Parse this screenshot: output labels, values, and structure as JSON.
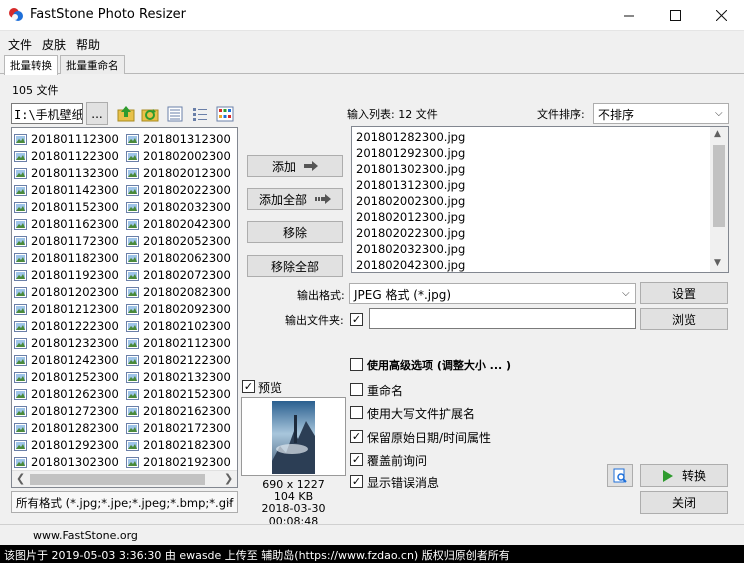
{
  "window": {
    "title": "FastStone Photo Resizer",
    "minimize": "—",
    "maximize": "☐",
    "close": "✕"
  },
  "menu": [
    "文件",
    "皮肤",
    "帮助"
  ],
  "tabs": [
    "批量转换",
    "批量重命名"
  ],
  "source": {
    "file_count": "105 文件",
    "path": "I:\\手机壁纸\\",
    "browse_label": "...",
    "col1": [
      "201801112300",
      "201801122300",
      "201801132300",
      "201801142300",
      "201801152300",
      "201801162300",
      "201801172300",
      "201801182300",
      "201801192300",
      "201801202300",
      "201801212300",
      "201801222300",
      "201801232300",
      "201801242300",
      "201801252300",
      "201801262300",
      "201801272300",
      "201801282300",
      "201801292300",
      "201801302300"
    ],
    "col2": [
      "201801312300",
      "201802002300",
      "201802012300",
      "201802022300",
      "201802032300",
      "201802042300",
      "201802052300",
      "201802062300",
      "201802072300",
      "201802082300",
      "201802092300",
      "201802102300",
      "201802112300",
      "201802122300",
      "201802132300",
      "201802152300",
      "201802162300",
      "201802172300",
      "201802182300",
      "201802192300"
    ],
    "filter": "所有格式 (*.jpg;*.jpe;*.jpeg;*.bmp;*.gif"
  },
  "buttons": {
    "add": "添加",
    "add_all": "添加全部",
    "remove": "移除",
    "remove_all": "移除全部",
    "settings": "设置",
    "browse": "浏览",
    "convert": "转换",
    "close": "关闭"
  },
  "dest": {
    "input_count": "输入列表: 12 文件",
    "sort_label": "文件排序:",
    "sort_value": "不排序",
    "files": [
      "201801282300.jpg",
      "201801292300.jpg",
      "201801302300.jpg",
      "201801312300.jpg",
      "201802002300.jpg",
      "201802012300.jpg",
      "201802022300.jpg",
      "201802032300.jpg",
      "201802042300.jpg"
    ]
  },
  "output": {
    "format_label": "输出格式:",
    "format_value": "JPEG 格式 (*.jpg)",
    "folder_label": "输出文件夹:",
    "folder_checked": true,
    "folder_value": ""
  },
  "options": {
    "advanced": {
      "label": "使用高级选项 (调整大小 ... )",
      "checked": false
    },
    "rename": {
      "label": "重命名",
      "checked": false
    },
    "uppercase_ext": {
      "label": "使用大写文件扩展名",
      "checked": false
    },
    "keep_datetime": {
      "label": "保留原始日期/时间属性",
      "checked": true
    },
    "overwrite_prompt": {
      "label": "覆盖前询问",
      "checked": true
    },
    "show_errors": {
      "label": "显示错误消息",
      "checked": true
    }
  },
  "preview": {
    "label": "预览",
    "checked": true,
    "dimensions": "690 x 1227",
    "size": "104 KB",
    "datetime": "2018-03-30 00:08:48"
  },
  "footer": {
    "link": "www.FastStone.org",
    "status": "该图片于 2019-05-03 3:36:30 由 ewasde 上传至 辅助岛(https://www.fzdao.cn) 版权归原创者所有"
  },
  "colors": {
    "accent_green": "#2e9b2e",
    "status_bar": "#000000"
  }
}
